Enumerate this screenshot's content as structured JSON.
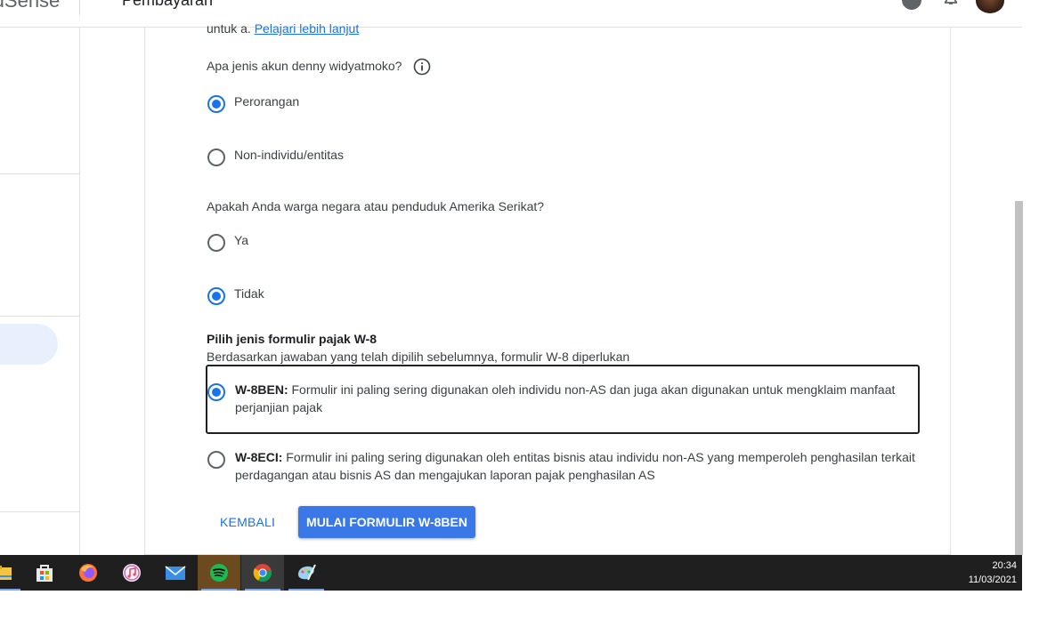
{
  "app": {
    "brand": "AdSense",
    "page_title": "Pembayaran"
  },
  "form": {
    "learn_more_prefix": "untuk a.",
    "learn_more_link": "Pelajari lebih lanjut",
    "account_type": {
      "question": "Apa jenis akun denny widyatmoko?",
      "options": [
        {
          "label": "Perorangan",
          "selected": true
        },
        {
          "label": "Non-individu/entitas",
          "selected": false
        }
      ]
    },
    "us_person": {
      "question": "Apakah Anda warga negara atau penduduk Amerika Serikat?",
      "options": [
        {
          "label": "Ya",
          "selected": false
        },
        {
          "label": "Tidak",
          "selected": true
        }
      ]
    },
    "tax_form": {
      "title": "Pilih jenis formulir pajak W-8",
      "description": "Berdasarkan jawaban yang telah dipilih sebelumnya, formulir W-8 diperlukan",
      "options": [
        {
          "code": "W-8BEN:",
          "text": "Formulir ini paling sering digunakan oleh individu non-AS dan juga akan digunakan untuk mengklaim manfaat perjanjian pajak",
          "selected": true
        },
        {
          "code": "W-8ECI:",
          "text": "Formulir ini paling sering digunakan oleh entitas bisnis atau individu non-AS yang memperoleh penghasilan terkait perdagangan atau bisnis AS dan mengajukan laporan pajak penghasilan AS",
          "selected": false
        }
      ]
    },
    "back_label": "KEMBALI",
    "start_label": "MULAI FORMULIR W-8BEN"
  },
  "taskbar": {
    "apps": [
      {
        "name": "file-explorer-icon",
        "color": "#f4c542"
      },
      {
        "name": "store-icon",
        "color": "#e8e8e8"
      },
      {
        "name": "firefox-icon",
        "color": "#ff7139"
      },
      {
        "name": "itunes-icon",
        "color": "#f2f2f2"
      },
      {
        "name": "mail-icon",
        "color": "#3b8ee5"
      },
      {
        "name": "spotify-icon",
        "color": "#1db954"
      },
      {
        "name": "chrome-icon",
        "color": "#4285f4"
      },
      {
        "name": "paint-icon",
        "color": "#9ad0f5"
      }
    ],
    "time": "20:34",
    "date": "11/03/2021"
  },
  "colors": {
    "accent": "#1a73e8",
    "primary_button": "#3b78e7",
    "taskbar": "#1f1f1f"
  }
}
